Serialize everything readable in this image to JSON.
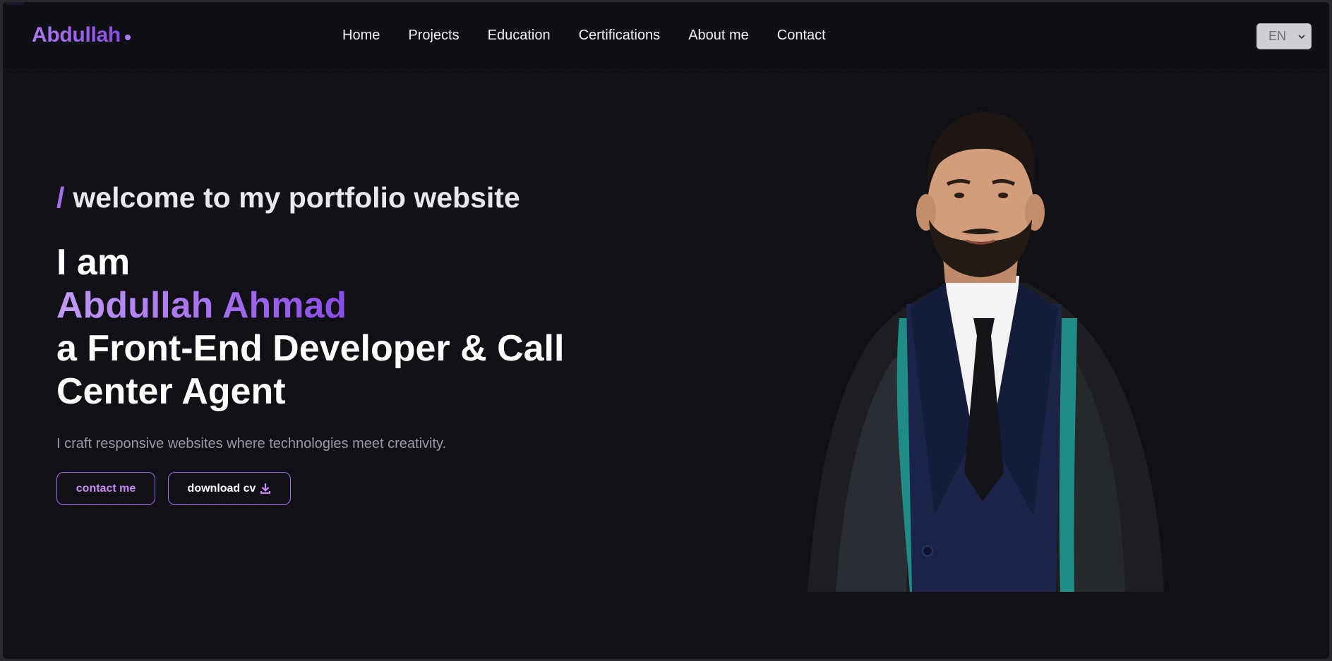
{
  "brand": {
    "name": "Abdullah"
  },
  "nav": {
    "items": [
      {
        "label": "Home"
      },
      {
        "label": "Projects"
      },
      {
        "label": "Education"
      },
      {
        "label": "Certifications"
      },
      {
        "label": "About me"
      },
      {
        "label": "Contact"
      }
    ]
  },
  "language": {
    "selected": "EN"
  },
  "hero": {
    "slash": "/",
    "welcome": "welcome to my portfolio website",
    "intro": "I am",
    "name": "Abdullah Ahmad",
    "role_line1": "a Front-End Developer & Call",
    "role_line2": "Center Agent",
    "tagline": "I craft responsive websites where technologies meet creativity.",
    "contact_button": "contact me",
    "cv_button": "download cv"
  },
  "icons": {
    "language_dropdown": "chevron-down-icon",
    "cv_button": "download-icon"
  },
  "colors": {
    "background": "#101016",
    "accent": "#a46cf0",
    "accent_light": "#c39af5",
    "text": "#ffffff",
    "muted_text": "#9a9aa4"
  }
}
